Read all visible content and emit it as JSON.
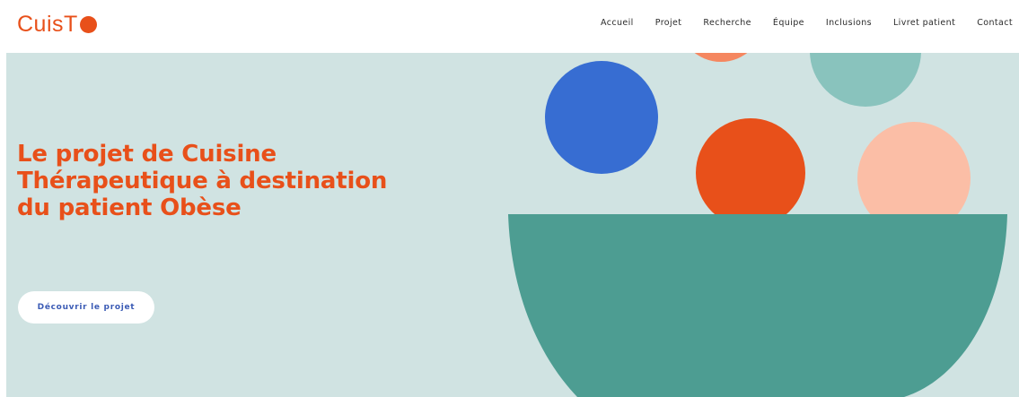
{
  "brand": {
    "name": "CuisT",
    "accent": "#e8501a"
  },
  "nav": {
    "items": [
      {
        "label": "Accueil"
      },
      {
        "label": "Projet"
      },
      {
        "label": "Recherche"
      },
      {
        "label": "Équipe"
      },
      {
        "label": "Inclusions"
      },
      {
        "label": "Livret patient"
      },
      {
        "label": "Contact"
      }
    ]
  },
  "hero": {
    "title": "Le projet de Cuisine Thérapeutique à destination du patient Obèse",
    "cta_label": "Découvrir le projet",
    "background": "#d0e3e2"
  },
  "illustration": {
    "colors": {
      "blue_ball": "#376dd2",
      "orange_ball": "#e8501a",
      "peach_ball": "#fbbea6",
      "teal_ball": "#89c3bd",
      "coral_ball": "#f58760",
      "bowl": "#4d9d92"
    }
  }
}
